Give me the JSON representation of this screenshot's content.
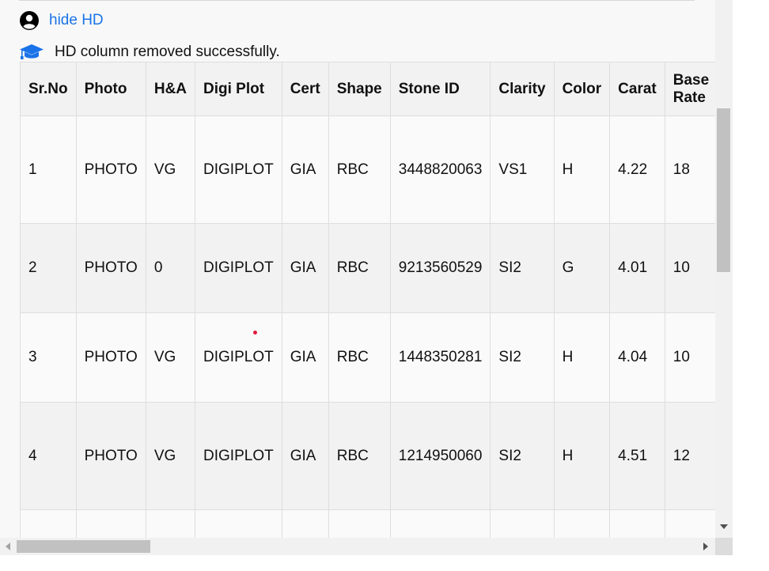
{
  "toggle": {
    "label": "hide HD",
    "icon": "user-circle-icon"
  },
  "message": {
    "text": "HD column removed successfully.",
    "icon": "graduation-cap-icon"
  },
  "colors": {
    "link": "#1a73e8",
    "icon_user": "#000000",
    "icon_cap": "#1a73e8"
  },
  "table": {
    "headers": [
      "Sr.No",
      "Photo",
      "H&A",
      "Digi Plot",
      "Cert",
      "Shape",
      "Stone ID",
      "Clarity",
      "Color",
      "Carat",
      "Base Rate"
    ],
    "rows": [
      [
        "1",
        "PHOTO",
        "VG",
        "DIGIPLOT",
        "GIA",
        "RBC",
        "3448820063",
        "VS1",
        "H",
        "4.22",
        "18"
      ],
      [
        "2",
        "PHOTO",
        "0",
        "DIGIPLOT",
        "GIA",
        "RBC",
        "9213560529",
        "SI2",
        "G",
        "4.01",
        "10"
      ],
      [
        "3",
        "PHOTO",
        "VG",
        "DIGIPLOT",
        "GIA",
        "RBC",
        "1448350281",
        "SI2",
        "H",
        "4.04",
        "10"
      ],
      [
        "4",
        "PHOTO",
        "VG",
        "DIGIPLOT",
        "GIA",
        "RBC",
        "1214950060",
        "SI2",
        "H",
        "4.51",
        "12"
      ],
      [
        "",
        "",
        "",
        "",
        "",
        "",
        "",
        "",
        "",
        "",
        ""
      ]
    ]
  }
}
